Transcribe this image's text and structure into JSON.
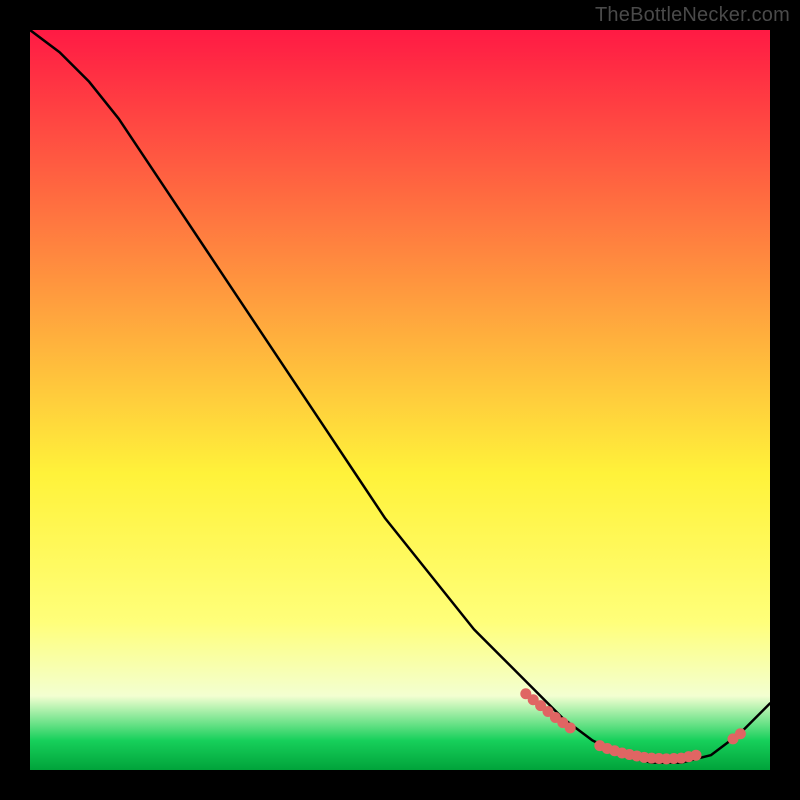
{
  "watermark": "TheBottleNecker.com",
  "colors": {
    "background": "#000000",
    "line": "#000000",
    "marker": "#e06563",
    "gradient_top": "#ff1a44",
    "gradient_mid_upper": "#ff8a2b",
    "gradient_mid": "#fff23a",
    "gradient_lower_yellow": "#ffff7a",
    "gradient_pale": "#f3ffd1",
    "gradient_green": "#17d05b",
    "gradient_bottom": "#00a33a"
  },
  "chart_data": {
    "type": "line",
    "title": "",
    "xlabel": "",
    "ylabel": "",
    "xlim": [
      0,
      100
    ],
    "ylim": [
      0,
      100
    ],
    "grid": false,
    "legend": false,
    "series": [
      {
        "name": "curve",
        "x": [
          0,
          4,
          8,
          12,
          16,
          20,
          24,
          28,
          32,
          36,
          40,
          44,
          48,
          52,
          56,
          60,
          64,
          68,
          72,
          76,
          80,
          84,
          88,
          92,
          96,
          100
        ],
        "values": [
          100,
          97,
          93,
          88,
          82,
          76,
          70,
          64,
          58,
          52,
          46,
          40,
          34,
          29,
          24,
          19,
          15,
          11,
          7,
          4,
          2,
          1,
          1,
          2,
          5,
          9
        ]
      }
    ],
    "markers": [
      {
        "x": 67,
        "y": 10.3
      },
      {
        "x": 68,
        "y": 9.5
      },
      {
        "x": 69,
        "y": 8.7
      },
      {
        "x": 70,
        "y": 7.9
      },
      {
        "x": 71,
        "y": 7.1
      },
      {
        "x": 72,
        "y": 6.4
      },
      {
        "x": 73,
        "y": 5.7
      },
      {
        "x": 77,
        "y": 3.3
      },
      {
        "x": 78,
        "y": 2.9
      },
      {
        "x": 79,
        "y": 2.6
      },
      {
        "x": 80,
        "y": 2.3
      },
      {
        "x": 81,
        "y": 2.1
      },
      {
        "x": 82,
        "y": 1.9
      },
      {
        "x": 83,
        "y": 1.7
      },
      {
        "x": 84,
        "y": 1.6
      },
      {
        "x": 85,
        "y": 1.55
      },
      {
        "x": 86,
        "y": 1.5
      },
      {
        "x": 87,
        "y": 1.55
      },
      {
        "x": 88,
        "y": 1.6
      },
      {
        "x": 89,
        "y": 1.8
      },
      {
        "x": 90,
        "y": 2.0
      },
      {
        "x": 95,
        "y": 4.2
      },
      {
        "x": 96,
        "y": 4.9
      }
    ],
    "gradient_bands": [
      {
        "from": 0,
        "to": 0.6,
        "c0": "gradient_top",
        "c1": "gradient_mid"
      },
      {
        "from": 0.6,
        "to": 0.8,
        "c0": "gradient_mid",
        "c1": "gradient_lower_yellow"
      },
      {
        "from": 0.8,
        "to": 0.9,
        "c0": "gradient_lower_yellow",
        "c1": "gradient_pale"
      },
      {
        "from": 0.9,
        "to": 0.96,
        "c0": "gradient_pale",
        "c1": "gradient_green"
      },
      {
        "from": 0.96,
        "to": 1.0,
        "c0": "gradient_green",
        "c1": "gradient_bottom"
      }
    ]
  }
}
